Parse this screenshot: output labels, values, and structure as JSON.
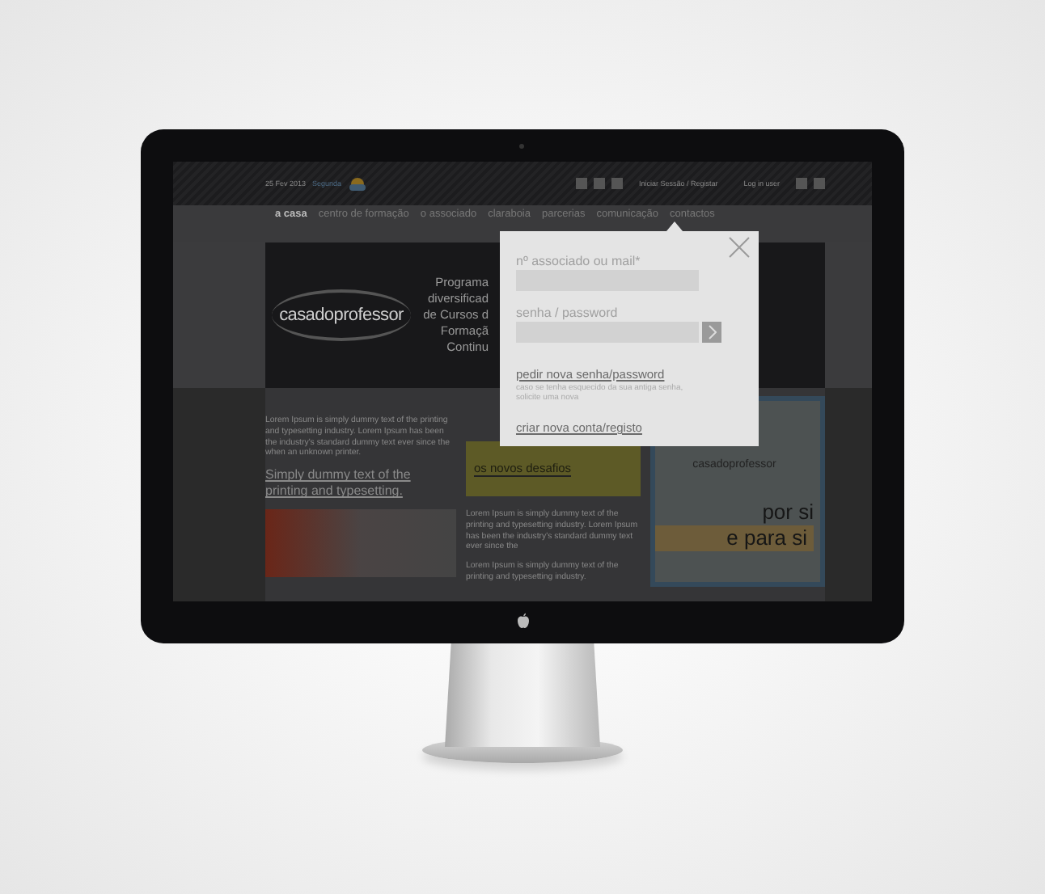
{
  "top_bar": {
    "date": "25 Fev 2013",
    "weekday": "Segunda",
    "links": [
      "Iniciar Sessão / Registar",
      "Log in user"
    ]
  },
  "nav": [
    {
      "label": "a casa",
      "selected": true
    },
    {
      "label": "centro de formação",
      "selected": false
    },
    {
      "label": "o associado",
      "selected": false
    },
    {
      "label": "claraboia",
      "selected": false
    },
    {
      "label": "parcerias",
      "selected": false
    },
    {
      "label": "comunicação",
      "selected": false
    },
    {
      "label": "contactos",
      "selected": false
    }
  ],
  "hero": {
    "logo": "casadoprofessor",
    "lines": [
      "Programa",
      "diversificad",
      "de Cursos d",
      "Formaçã",
      "Continu"
    ]
  },
  "article": {
    "body": "Lorem Ipsum is simply dummy text of the printing and typesetting industry. Lorem Ipsum has been the industry's standard dummy text ever since the when an unknown printer.",
    "headline": "Simply dummy text of the printing and typesetting."
  },
  "middle": {
    "banner_title": "os novos desafios",
    "paragraphs": [
      "Lorem Ipsum is simply dummy text of the printing and typesetting industry. Lorem Ipsum has been the industry's standard dummy text ever since the",
      "Lorem Ipsum is simply dummy text of the printing and typesetting industry."
    ]
  },
  "ad": {
    "logo": "casadoprofessor",
    "lines": [
      "por si",
      "e para si"
    ]
  },
  "login": {
    "user_label": "nº associado ou mail*",
    "password_label": "senha / password",
    "forgot_link": "pedir nova senha/password",
    "forgot_hint": "caso se tenha esquecido da sua antiga senha, solicite uma nova",
    "register_link": "criar nova conta/registo"
  }
}
